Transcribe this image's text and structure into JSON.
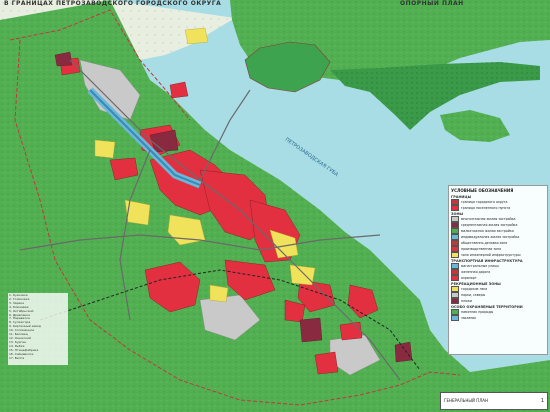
{
  "header": {
    "title": "В ГРАНИЦАХ ПЕТРОЗАВОДСКОГО ГОРОДСКОГО ОКРУГА",
    "right_title": "ОПОРНЫЙ ПЛАН"
  },
  "map": {
    "bay_label": "ПЕТРОЗАВОДСКАЯ ГУБА",
    "colors": {
      "water": "#a8dde6",
      "forest": "#4fb04f",
      "forest_dark": "#2f8f3f",
      "residential": "#e03040",
      "industrial": "#c8c8c8",
      "roads": "#6a6a6a"
    }
  },
  "legend": {
    "title": "УСЛОВНЫЕ ОБОЗНАЧЕНИЯ",
    "sections": [
      {
        "heading": "ГРАНИЦЫ",
        "items": [
          "граница городского округа",
          "граница населенного пункта"
        ]
      },
      {
        "heading": "ЗОНЫ",
        "items": [
          "многоэтажная жилая застройка",
          "среднеэтажная жилая застройка",
          "малоэтажная жилая застройка",
          "индивидуальная жилая застройка",
          "общественно-деловая зона",
          "производственная зона",
          "зона инженерной инфраструктуры"
        ]
      },
      {
        "heading": "ТРАНСПОРТНАЯ ИНФРАСТРУКТУРА",
        "items": [
          "магистральные улицы",
          "железная дорога",
          "аэропорт"
        ]
      },
      {
        "heading": "РЕКРЕАЦИОННЫЕ ЗОНЫ",
        "items": [
          "городские леса",
          "парки, скверы",
          "пляжи"
        ]
      },
      {
        "heading": "ОСОБО ОХРАНЯЕМЫЕ ТЕРРИТОРИИ",
        "items": [
          "памятник природы",
          "заказник"
        ]
      }
    ]
  },
  "left_legend": {
    "items": [
      "Кукковка",
      "Голиковка",
      "Зарека",
      "Ключевая",
      "Октябрьский",
      "Древлянка",
      "Перевалка",
      "Сулажгора",
      "Кирпичный завод",
      "Соломенное",
      "Бесовец",
      "Онежский",
      "Курган",
      "Рыбка",
      "Птицефабрика",
      "Сайнаволок",
      "Вилга"
    ]
  },
  "title_block": {
    "label": "ГЕНЕРАЛЬНЫЙ ПЛАН",
    "sheet": "1"
  }
}
